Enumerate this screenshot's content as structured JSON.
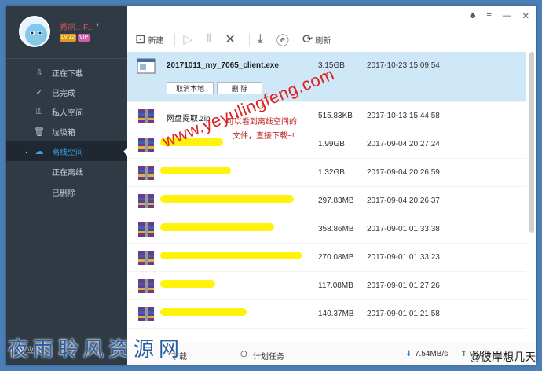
{
  "user": {
    "name": "秀夙…F...",
    "level": "LV.12",
    "vip": "VIP"
  },
  "sidebar": {
    "items": [
      {
        "label": "正在下载",
        "icon": "download-icon"
      },
      {
        "label": "已完成",
        "icon": "check-circle-icon"
      },
      {
        "label": "私人空间",
        "icon": "lock-icon"
      },
      {
        "label": "垃圾箱",
        "icon": "trash-icon"
      },
      {
        "label": "离线空间",
        "icon": "cloud-icon",
        "active": true
      }
    ],
    "sub_items": [
      {
        "label": "正在离线"
      },
      {
        "label": "已删除"
      }
    ],
    "app_label": "应用"
  },
  "toolbar": {
    "new_label": "新建",
    "refresh_label": "刷新"
  },
  "files": [
    {
      "name": "20171011_my_7065_client.exe",
      "size": "3.15GB",
      "time": "2017-10-23 15:09:54",
      "selected": true
    },
    {
      "name": "网盘提取.zip",
      "size": "515.83KB",
      "time": "2017-10-13 15:44:58"
    },
    {
      "name": "",
      "size": "1.99GB",
      "time": "2017-09-04 20:27:24"
    },
    {
      "name": "",
      "size": "1.32GB",
      "time": "2017-09-04 20:26:59"
    },
    {
      "name": "",
      "size": "297.83MB",
      "time": "2017-09-04 20:26:37"
    },
    {
      "name": "",
      "size": "358.86MB",
      "time": "2017-09-01 01:33:38"
    },
    {
      "name": "",
      "size": "270.08MB",
      "time": "2017-09-01 01:33:23"
    },
    {
      "name": "",
      "size": "117.08MB",
      "time": "2017-09-01 01:27:26"
    },
    {
      "name": "",
      "size": "140.37MB",
      "time": "2017-09-01 01:21:58"
    }
  ],
  "row_actions": {
    "cancel_local": "取消本地",
    "delete": "删 除"
  },
  "status": {
    "downloads": "下载",
    "plan_tasks": "计划任务",
    "down_speed": "7.54MB/s",
    "up_speed": "0KB/s"
  },
  "watermarks": {
    "url": "www.yeyulingfeng.com",
    "note_line1": "可以看到离线空间的",
    "note_line2": "文件，直接下载~!",
    "site": "夜雨聆风资源网",
    "weibo": "@彼岸想几天"
  },
  "colors": {
    "sidebar_bg": "#2f3a45",
    "accent": "#3a9ee8",
    "selected_row": "#cfe8f8",
    "watermark_red": "#e02020",
    "highlight": "#fff200"
  }
}
